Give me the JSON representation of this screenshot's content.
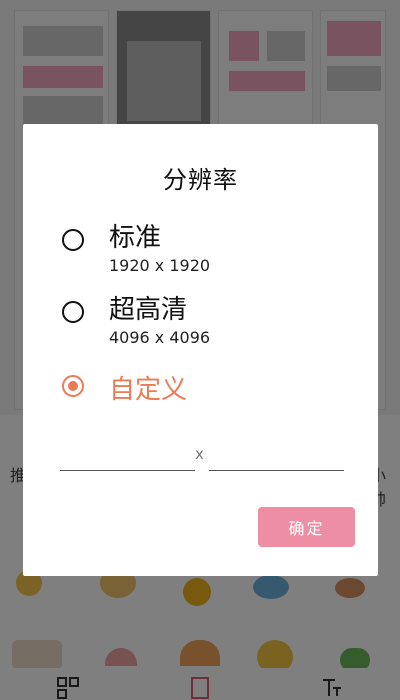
{
  "dialog": {
    "title": "分辨率",
    "options": [
      {
        "label": "标准",
        "sub": "1920 x 1920",
        "selected": false
      },
      {
        "label": "超高清",
        "sub": "4096 x 4096",
        "selected": false
      },
      {
        "label": "自定义",
        "sub": "",
        "selected": true
      }
    ],
    "width_value": "",
    "height_value": "",
    "separator": "x",
    "confirm_label": "确定"
  },
  "background": {
    "left_text": "推",
    "right_text": "小帅"
  },
  "colors": {
    "accent": "#e97b55",
    "confirm_bg": "#ee8ea5"
  }
}
